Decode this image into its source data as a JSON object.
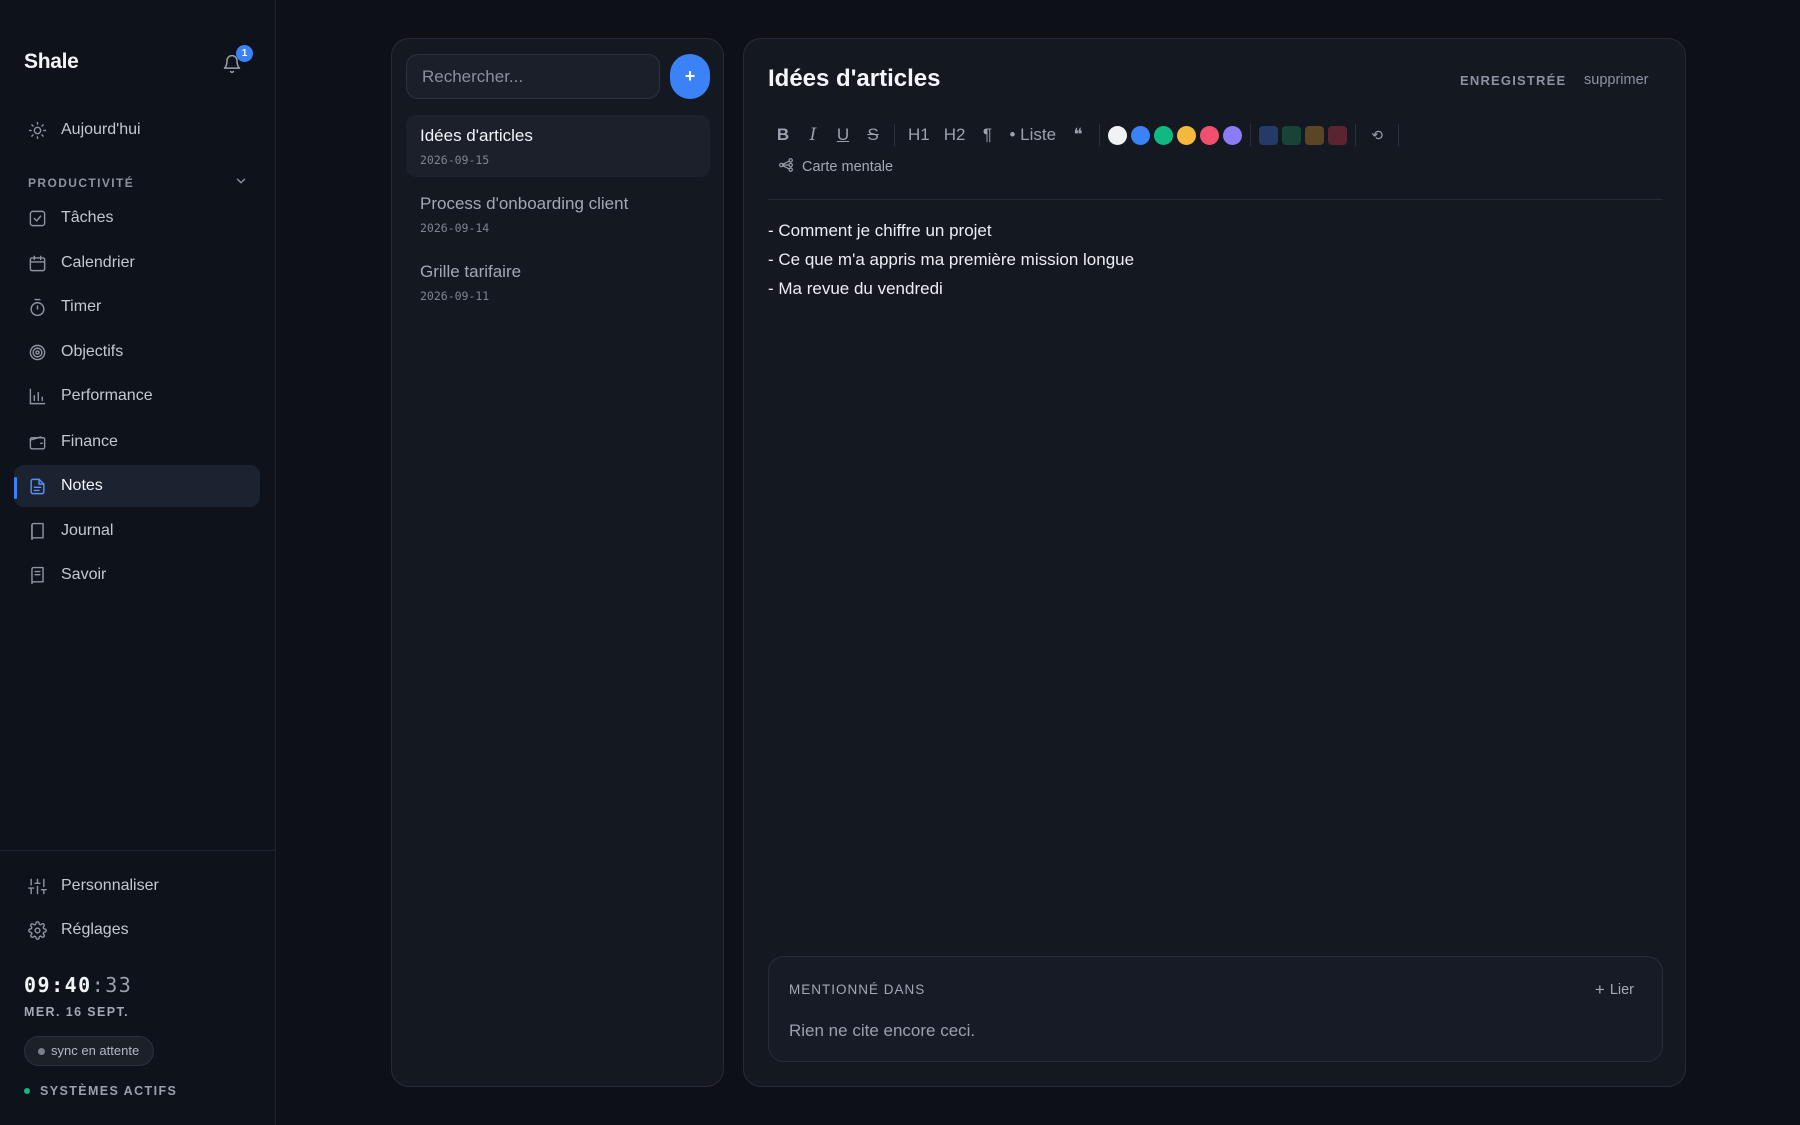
{
  "app": {
    "brand": "Shale",
    "notification_count": "1"
  },
  "sidebar": {
    "today_label": "Aujourd'hui",
    "section_label": "PRODUCTIVITÉ",
    "items": [
      {
        "label": "Tâches",
        "icon": "checkbox-icon"
      },
      {
        "label": "Calendrier",
        "icon": "calendar-icon"
      },
      {
        "label": "Timer",
        "icon": "stopwatch-icon"
      },
      {
        "label": "Objectifs",
        "icon": "target-icon"
      },
      {
        "label": "Performance",
        "icon": "bar-chart-icon"
      },
      {
        "label": "Finance",
        "icon": "wallet-icon"
      },
      {
        "label": "Notes",
        "icon": "note-icon",
        "active": true
      },
      {
        "label": "Journal",
        "icon": "book-icon"
      },
      {
        "label": "Savoir",
        "icon": "book-text-icon"
      }
    ],
    "customize_label": "Personnaliser",
    "settings_label": "Réglages",
    "clock_hm": "09:40",
    "clock_sec": ":33",
    "date": "MER. 16 SEPT.",
    "sync_status": "sync en attente",
    "systems_status": "SYSTÈMES ACTIFS"
  },
  "notes_list": {
    "search_placeholder": "Rechercher...",
    "add_label": "+",
    "items": [
      {
        "title": "Idées d'articles",
        "date": "2026-09-15",
        "active": true
      },
      {
        "title": "Process d'onboarding client",
        "date": "2026-09-14"
      },
      {
        "title": "Grille tarifaire",
        "date": "2026-09-11"
      }
    ]
  },
  "editor": {
    "title": "Idées d'articles",
    "saved_label": "ENREGISTRÉE",
    "delete_label": "supprimer",
    "toolbar": {
      "bold": "B",
      "italic": "I",
      "underline": "U",
      "strike": "S",
      "h1": "H1",
      "h2": "H2",
      "paragraph": "¶",
      "list": "• Liste",
      "quote": "❝",
      "undo": "⟲",
      "text_colors": [
        "#f1f2f4",
        "#3b82f6",
        "#10b981",
        "#f5b83d",
        "#f0506e",
        "#8b7cf6"
      ],
      "highlight_colors": [
        "#253a66",
        "#164538",
        "#5a4526",
        "#5a2430"
      ]
    },
    "mindmap_label": "Carte mentale",
    "lines": [
      "- Comment je chiffre un projet",
      "- Ce que m'a appris ma première mission longue",
      "- Ma revue du vendredi"
    ],
    "mentions": {
      "title": "MENTIONNÉ DANS",
      "link_label": "Lier",
      "empty_text": "Rien ne cite encore ceci."
    }
  }
}
